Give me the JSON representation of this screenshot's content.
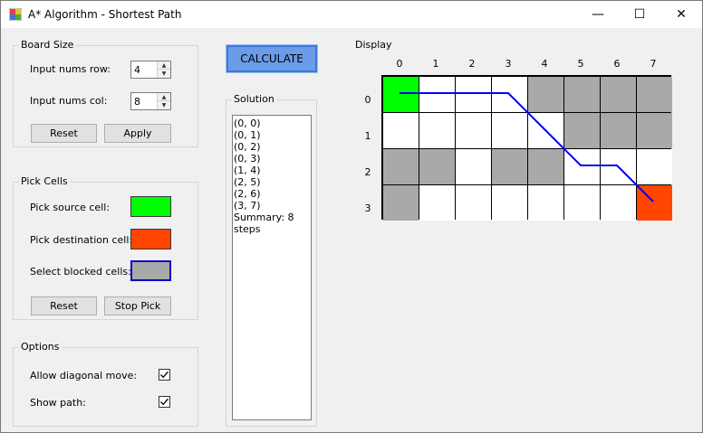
{
  "window": {
    "title": "A* Algorithm - Shortest Path",
    "minimize_glyph": "—",
    "maximize_glyph": "☐",
    "close_glyph": "✕"
  },
  "board_size": {
    "legend": "Board Size",
    "rows_label": "Input nums row:",
    "rows_value": "4",
    "cols_label": "Input nums col:",
    "cols_value": "8",
    "reset_label": "Reset",
    "apply_label": "Apply"
  },
  "pick_cells": {
    "legend": "Pick Cells",
    "source_label": "Pick source cell:",
    "destination_label": "Pick destination cell:",
    "blocked_label": "Select blocked cells:",
    "reset_label": "Reset",
    "stop_label": "Stop Pick",
    "source_color": "#00ff00",
    "destination_color": "#ff4500",
    "blocked_color": "#a9a9a9"
  },
  "options": {
    "legend": "Options",
    "diagonal_label": "Allow diagonal move:",
    "diagonal_checked": true,
    "show_path_label": "Show path:",
    "show_path_checked": true
  },
  "calculate_label": "CALCULATE",
  "solution": {
    "legend": "Solution",
    "lines": [
      "(0, 0)",
      "(0, 1)",
      "(0, 2)",
      "(0, 3)",
      "(1, 4)",
      "(2, 5)",
      "(2, 6)",
      "(3, 7)",
      "Summary: 8 steps"
    ]
  },
  "display": {
    "legend": "Display",
    "col_labels": [
      "0",
      "1",
      "2",
      "3",
      "4",
      "5",
      "6",
      "7"
    ],
    "row_labels": [
      "0",
      "1",
      "2",
      "3"
    ],
    "rows": 4,
    "cols": 8,
    "source": [
      0,
      0
    ],
    "destination": [
      3,
      7
    ],
    "blocked": [
      [
        0,
        4
      ],
      [
        0,
        5
      ],
      [
        0,
        6
      ],
      [
        0,
        7
      ],
      [
        1,
        5
      ],
      [
        1,
        6
      ],
      [
        1,
        7
      ],
      [
        2,
        0
      ],
      [
        2,
        1
      ],
      [
        2,
        3
      ],
      [
        2,
        4
      ],
      [
        3,
        0
      ]
    ],
    "path_color": "#0000ff"
  }
}
